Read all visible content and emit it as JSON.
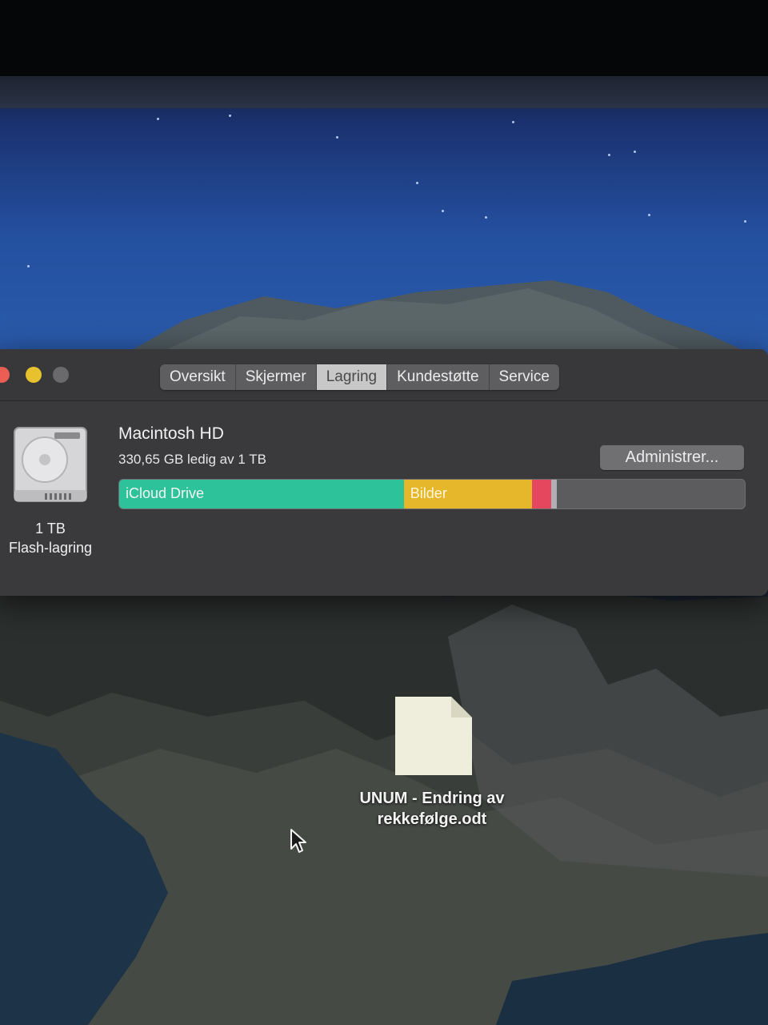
{
  "window": {
    "tabs": [
      {
        "label": "Oversikt",
        "active": false
      },
      {
        "label": "Skjermer",
        "active": false
      },
      {
        "label": "Lagring",
        "active": true
      },
      {
        "label": "Kundestøtte",
        "active": false
      },
      {
        "label": "Service",
        "active": false
      }
    ],
    "traffic_lights": {
      "close": "#ec5e55",
      "minimize": "#e8c22e",
      "zoom": "#6a6a6c"
    }
  },
  "storage": {
    "disk": {
      "icon": "hard-drive-icon",
      "capacity": "1 TB",
      "type": "Flash-lagring",
      "name": "Macintosh HD",
      "free_text": "330,65 GB ledig av 1 TB"
    },
    "manage_button": "Administrer...",
    "bar": {
      "segments": [
        {
          "label": "iCloud Drive",
          "fraction": 0.455,
          "color": "#2ec29a"
        },
        {
          "label": "Bilder",
          "fraction": 0.205,
          "color": "#e6b72a"
        },
        {
          "label": "",
          "fraction": 0.03,
          "color": "#e4475e"
        },
        {
          "label": "",
          "fraction": 0.01,
          "color": "#b0b0b4"
        }
      ],
      "free_color": "#5c5c5e"
    }
  },
  "desktop": {
    "file": {
      "icon": "document-file-icon",
      "name_line1": "UNUM - Endring av",
      "name_line2": "rekkefølge.odt"
    },
    "cursor": "pointer-arrow-icon"
  }
}
